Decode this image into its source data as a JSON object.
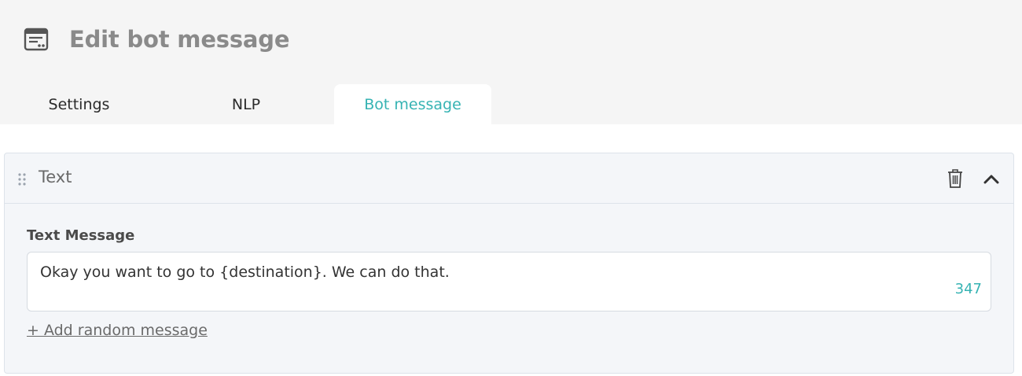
{
  "header": {
    "title": "Edit bot message",
    "icon": "message-card-icon"
  },
  "tabs": [
    {
      "label": "Settings",
      "active": false
    },
    {
      "label": "NLP",
      "active": false
    },
    {
      "label": "Bot message",
      "active": true
    }
  ],
  "colors": {
    "accent": "#36b3b3",
    "header_bg": "#f5f5f5",
    "card_bg": "#f4f6f9"
  },
  "block": {
    "title": "Text",
    "field_label": "Text Message",
    "message_value": "Okay you want to go to {destination}. We can do that.",
    "char_count": "347",
    "add_random_label": "+ Add random message"
  }
}
